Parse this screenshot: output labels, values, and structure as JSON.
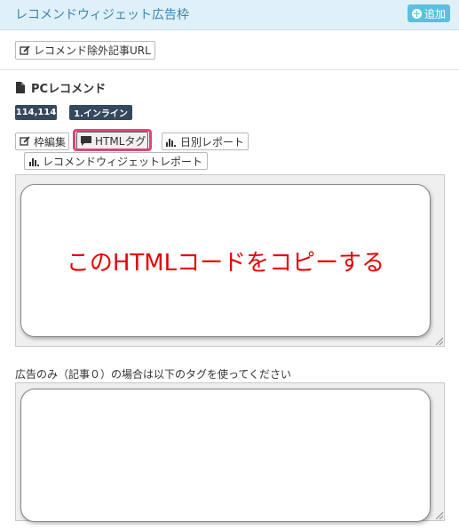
{
  "header": {
    "title": "レコメンドウィジェット広告枠",
    "add_label": "追加"
  },
  "toolbar_top": {
    "exclude_label": "レコメンド除外記事URL"
  },
  "section": {
    "title": "PCレコメンド",
    "badges": [
      "114,114",
      "1.インライン"
    ]
  },
  "actions": {
    "edit_label": "枠編集",
    "html_tag_label": "HTMLタグ",
    "daily_report_label": "日別レポート",
    "widget_report_label": "レコメンドウィジェットレポート"
  },
  "overlay": {
    "message": "このHTMLコードをコピーする"
  },
  "ad_only": {
    "label": "広告のみ（記事０）の場合は以下のタグを使ってください"
  },
  "colors": {
    "header_bg": "#dff0f8",
    "header_text": "#3a87ad",
    "add_button": "#5bc0de",
    "badge_bg": "#34495e",
    "highlight": "#e0447b",
    "copy_message": "#e60000"
  }
}
